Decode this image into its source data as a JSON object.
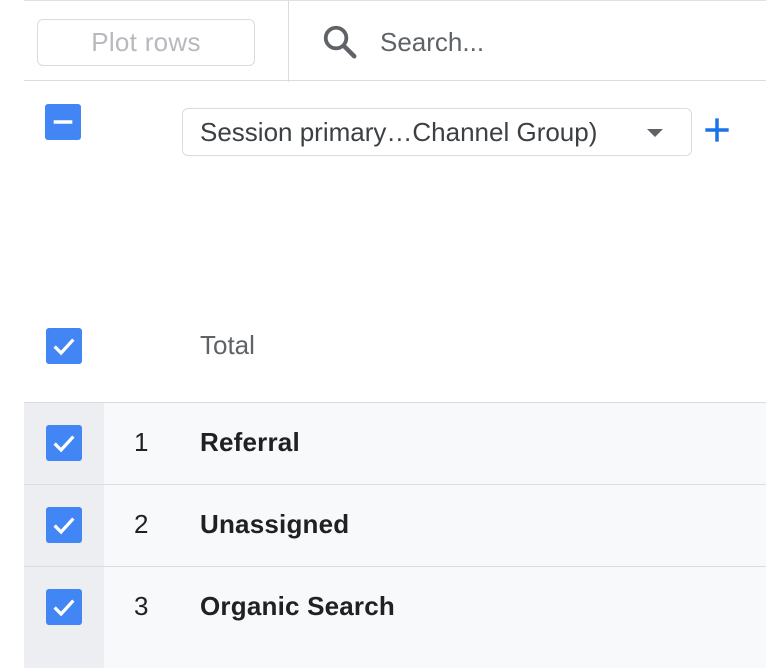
{
  "toolbar": {
    "plot_rows_label": "Plot rows",
    "search_placeholder": "Search..."
  },
  "dimension": {
    "selected_label": "Session primary…Channel Group)"
  },
  "total": {
    "label": "Total"
  },
  "rows": [
    {
      "index": "1",
      "name": "Referral"
    },
    {
      "index": "2",
      "name": "Unassigned"
    },
    {
      "index": "3",
      "name": "Organic Search"
    }
  ],
  "colors": {
    "checkbox": "#4285f4",
    "accent": "#1a73e8",
    "row_background": "#f8f9fa"
  },
  "icons": {
    "search": "search-icon",
    "add": "plus-icon",
    "dropdown": "caret-down-icon",
    "indeterminate": "minus-icon",
    "checked": "check-icon"
  }
}
